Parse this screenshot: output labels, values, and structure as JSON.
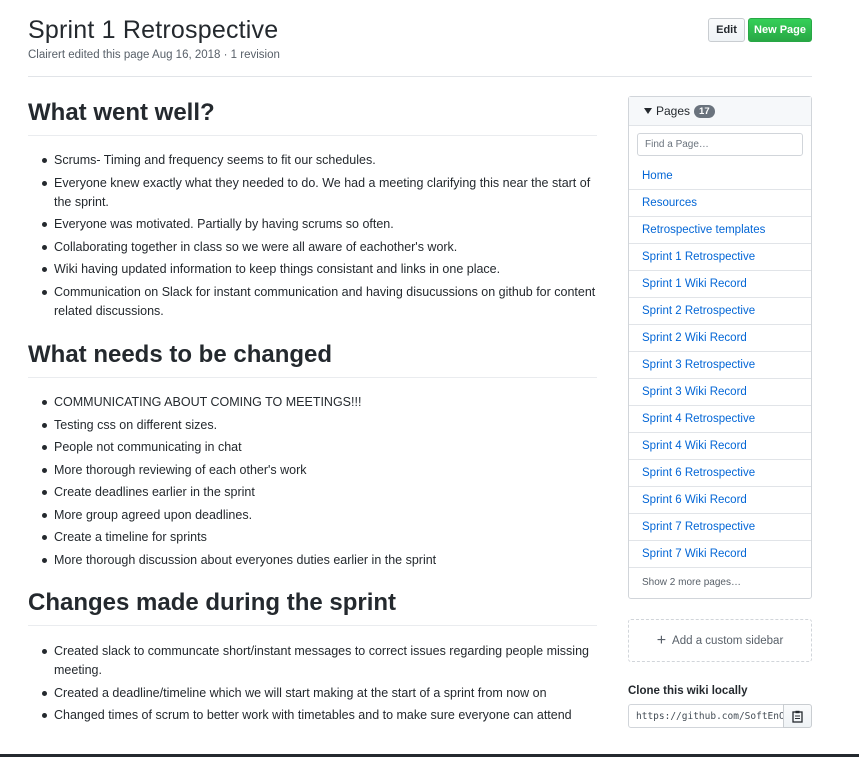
{
  "header": {
    "title": "Sprint 1 Retrospective",
    "meta": "Clairert edited this page Aug 16, 2018 · 1 revision",
    "edit_label": "Edit",
    "new_page_label": "New Page"
  },
  "sections": [
    {
      "heading": "What went well?",
      "items": [
        "Scrums- Timing and frequency seems to fit our schedules.",
        "Everyone knew exactly what they needed to do. We had a meeting clarifying this near the start of the sprint.",
        "Everyone was motivated. Partially by having scrums so often.",
        "Collaborating together in class so we were all aware of eachother's work.",
        "Wiki having updated information to keep things consistant and links in one place.",
        "Communication on Slack for instant communication and having disucussions on github for content related discussions."
      ]
    },
    {
      "heading": "What needs to be changed",
      "items": [
        "COMMUNICATING ABOUT COMING TO MEETINGS!!!",
        "Testing css on different sizes.",
        "People not communicating in chat",
        "More thorough reviewing of each other's work",
        "Create deadlines earlier in the sprint",
        "More group agreed upon deadlines.",
        "Create a timeline for sprints",
        "More thorough discussion about everyones duties earlier in the sprint"
      ]
    },
    {
      "heading": "Changes made during the sprint",
      "items": [
        "Created slack to communcate short/instant messages to correct issues regarding people missing meeting.",
        "Created a deadline/timeline which we will start making at the start of a sprint from now on",
        "Changed times of scrum to better work with timetables and to make sure everyone can attend"
      ]
    }
  ],
  "sidebar": {
    "pages_label": "Pages",
    "pages_count": "17",
    "find_placeholder": "Find a Page…",
    "pages": [
      "Home",
      "Resources",
      "Retrospective templates",
      "Sprint 1 Retrospective",
      "Sprint 1 Wiki Record",
      "Sprint 2 Retrospective",
      "Sprint 2 Wiki Record",
      "Sprint 3 Retrospective",
      "Sprint 3 Wiki Record",
      "Sprint 4 Retrospective",
      "Sprint 4 Wiki Record",
      "Sprint 6 Retrospective",
      "Sprint 6 Wiki Record",
      "Sprint 7 Retrospective",
      "Sprint 7 Wiki Record"
    ],
    "show_more": "Show 2 more pages…",
    "custom_sidebar": "Add a custom sidebar",
    "clone_label": "Clone this wiki locally",
    "clone_url": "https://github.com/SoftEnOP/"
  },
  "colors": {
    "link": "#0366d6",
    "primary_button": "#28a745"
  }
}
